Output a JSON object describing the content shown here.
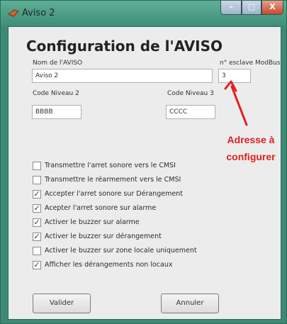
{
  "window": {
    "title": "Aviso 2",
    "buttons": {
      "minimize": "–",
      "maximize": "□",
      "close": "X"
    }
  },
  "form": {
    "heading": "Configuration de l'AVISO",
    "name_label": "Nom de l'AVISO",
    "name_value": "Aviso 2",
    "modbus_label": "n° esclave ModBus",
    "modbus_value": "3",
    "level2_label": "Code Niveau 2",
    "level2_value": "BBBB",
    "level3_label": "Code Niveau 3",
    "level3_value": "CCCC"
  },
  "options": [
    {
      "label": "Transmettre l'arret sonore vers le CMSI",
      "checked": false
    },
    {
      "label": "Transmettre le réarmement vers le CMSI",
      "checked": false
    },
    {
      "label": "Accepter l'arret sonore sur Dérangement",
      "checked": true
    },
    {
      "label": "Acepter l'arret sonore sur alarme",
      "checked": true
    },
    {
      "label": "Activer le buzzer sur alarme",
      "checked": true
    },
    {
      "label": "Activer le buzzer sur dérangement",
      "checked": true
    },
    {
      "label": "Activer le buzzer  sur zone locale uniquement",
      "checked": false
    },
    {
      "label": "Afficher les dérangements non locaux",
      "checked": true
    }
  ],
  "actions": {
    "validate": "Valider",
    "cancel": "Annuler"
  },
  "annotation": {
    "line1": "Adresse à",
    "line2": "configurer",
    "color": "#e0201e"
  },
  "icons": {
    "app": "app-icon",
    "check": "checkmark-icon",
    "arrow": "red-arrow-icon"
  }
}
